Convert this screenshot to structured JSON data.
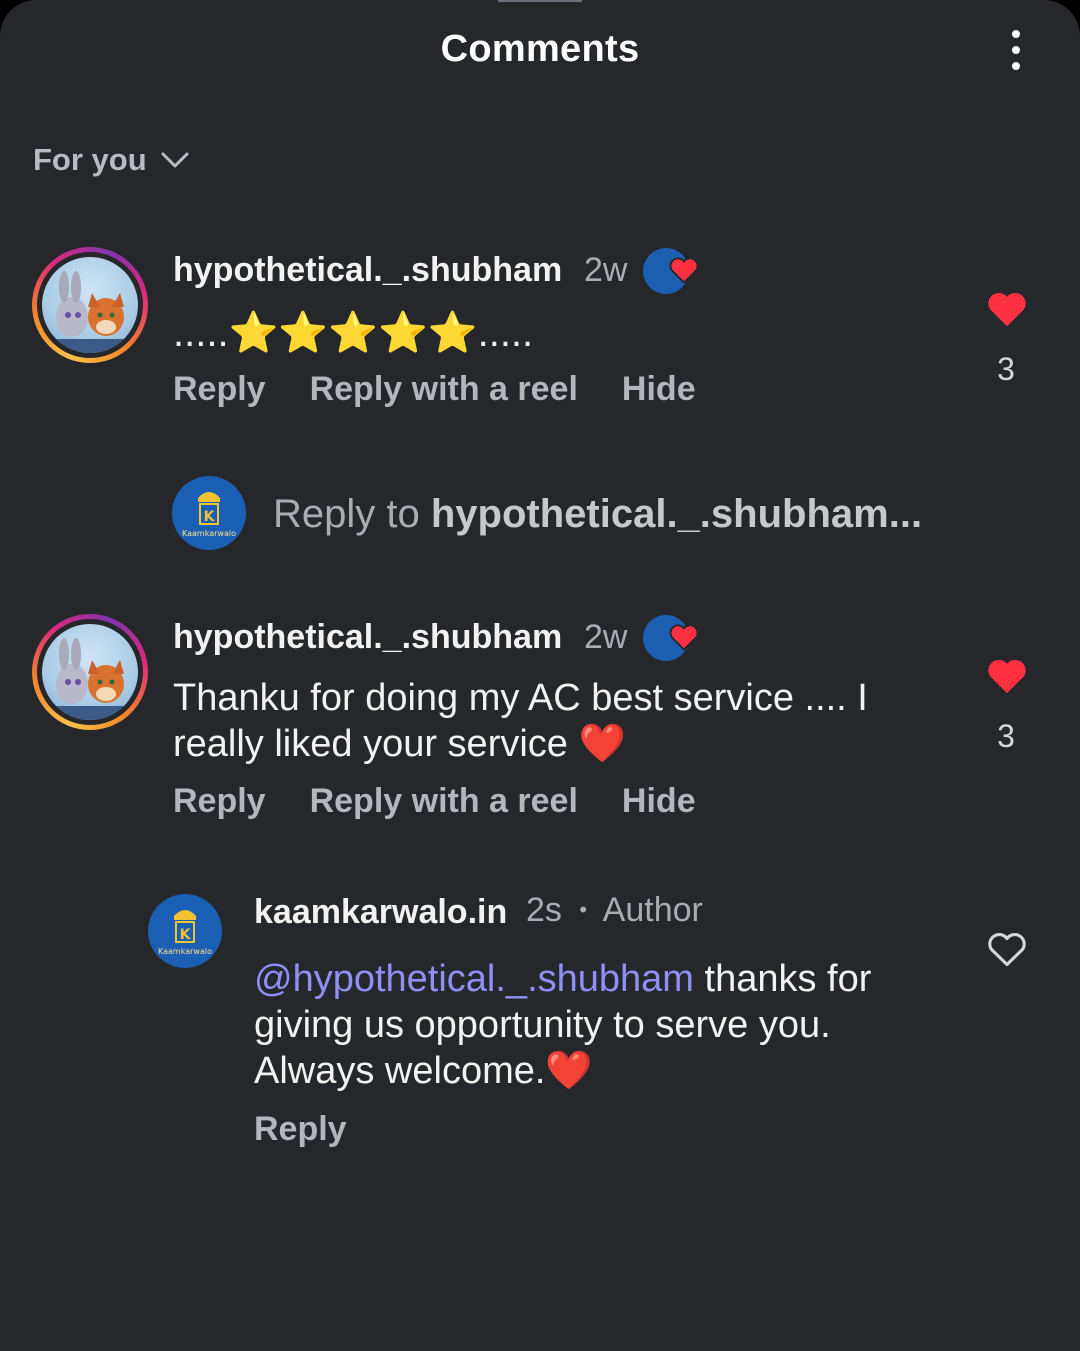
{
  "header": {
    "title": "Comments",
    "more_icon": "more-vertical-icon"
  },
  "filter": {
    "label": "For you",
    "icon": "chevron-down-icon"
  },
  "comments": [
    {
      "username": "hypothetical._.shubham",
      "time": "2w",
      "text": ".....⭐⭐⭐⭐⭐.....",
      "actions": {
        "reply": "Reply",
        "reply_reel": "Reply with a reel",
        "hide": "Hide"
      },
      "likes": "3",
      "liked": true
    },
    {
      "username": "hypothetical._.shubham",
      "time": "2w",
      "text": "Thanku for doing my AC best service .... I really liked your service ❤️",
      "actions": {
        "reply": "Reply",
        "reply_reel": "Reply with a reel",
        "hide": "Hide"
      },
      "likes": "3",
      "liked": true
    }
  ],
  "reply_box": {
    "prefix": "Reply to ",
    "target": "hypothetical._.shubham..."
  },
  "author_reply": {
    "username": "kaamkarwalo.in",
    "time": "2s",
    "separator": "•",
    "role": "Author",
    "mention": "@hypothetical._.shubham",
    "text": " thanks for giving us opportunity to serve you. Always welcome.❤️",
    "action": "Reply",
    "liked": false
  },
  "logo": {
    "caption": "Kaamkarwalo"
  },
  "colors": {
    "background": "#25272b",
    "like_red": "#ff3040",
    "mention": "#8f8ff5"
  }
}
